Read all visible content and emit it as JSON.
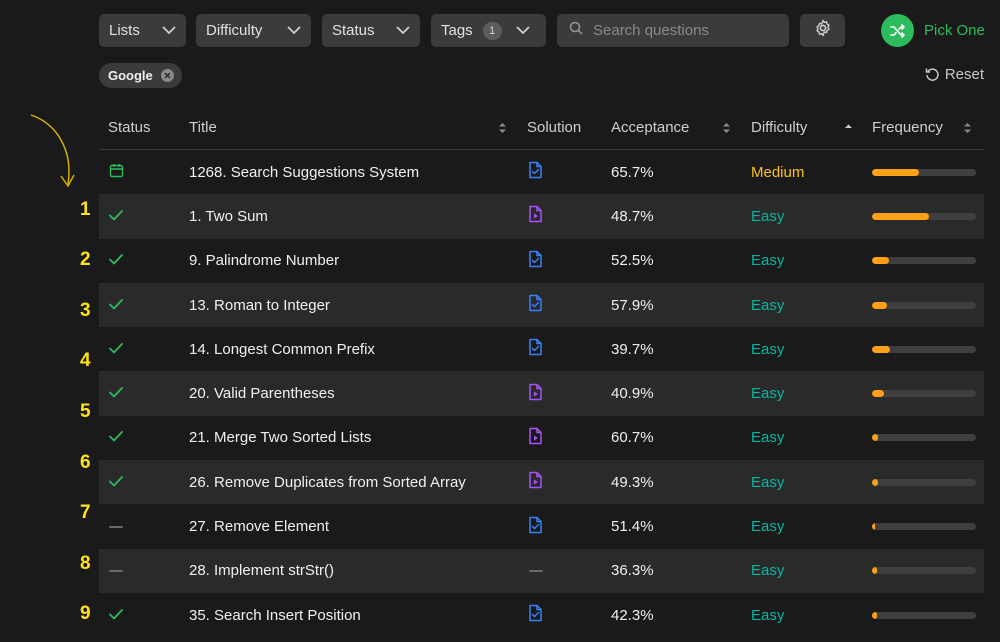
{
  "filters": {
    "lists_label": "Lists",
    "difficulty_label": "Difficulty",
    "status_label": "Status",
    "tags_label": "Tags",
    "tags_count": "1",
    "search_placeholder": "Search questions",
    "pick_label": "Pick One"
  },
  "active_chip": "Google",
  "reset_label": "Reset",
  "columns": {
    "status": "Status",
    "title": "Title",
    "solution": "Solution",
    "acceptance": "Acceptance",
    "difficulty": "Difficulty",
    "frequency": "Frequency"
  },
  "rows": [
    {
      "status": "calendar",
      "title": "1268. Search Suggestions System",
      "solution": "article",
      "acceptance": "65.7%",
      "difficulty": "Medium",
      "frequency": 0.45
    },
    {
      "status": "solved",
      "title": "1. Two Sum",
      "solution": "video",
      "acceptance": "48.7%",
      "difficulty": "Easy",
      "frequency": 0.55
    },
    {
      "status": "solved",
      "title": "9. Palindrome Number",
      "solution": "article",
      "acceptance": "52.5%",
      "difficulty": "Easy",
      "frequency": 0.16
    },
    {
      "status": "solved",
      "title": "13. Roman to Integer",
      "solution": "article",
      "acceptance": "57.9%",
      "difficulty": "Easy",
      "frequency": 0.14
    },
    {
      "status": "solved",
      "title": "14. Longest Common Prefix",
      "solution": "article",
      "acceptance": "39.7%",
      "difficulty": "Easy",
      "frequency": 0.17
    },
    {
      "status": "solved",
      "title": "20. Valid Parentheses",
      "solution": "video",
      "acceptance": "40.9%",
      "difficulty": "Easy",
      "frequency": 0.12
    },
    {
      "status": "solved",
      "title": "21. Merge Two Sorted Lists",
      "solution": "video",
      "acceptance": "60.7%",
      "difficulty": "Easy",
      "frequency": 0.06
    },
    {
      "status": "solved",
      "title": "26. Remove Duplicates from Sorted Array",
      "solution": "video",
      "acceptance": "49.3%",
      "difficulty": "Easy",
      "frequency": 0.06
    },
    {
      "status": "none",
      "title": "27. Remove Element",
      "solution": "article",
      "acceptance": "51.4%",
      "difficulty": "Easy",
      "frequency": 0.03
    },
    {
      "status": "none",
      "title": "28. Implement strStr()",
      "solution": "none",
      "acceptance": "36.3%",
      "difficulty": "Easy",
      "frequency": 0.05
    },
    {
      "status": "solved",
      "title": "35. Search Insert Position",
      "solution": "article",
      "acceptance": "42.3%",
      "difficulty": "Easy",
      "frequency": 0.05
    }
  ],
  "annotations": [
    "1",
    "2",
    "3",
    "4",
    "5",
    "6",
    "7",
    "8",
    "9"
  ],
  "colors": {
    "accent_green": "#2cbb5d",
    "easy": "#00b8a3",
    "medium": "#ffc01e",
    "frequency_fill": "#ffa116",
    "annotation_yellow": "#ffe11a",
    "solution_article": "#3b82f6",
    "solution_video": "#a855f7"
  }
}
